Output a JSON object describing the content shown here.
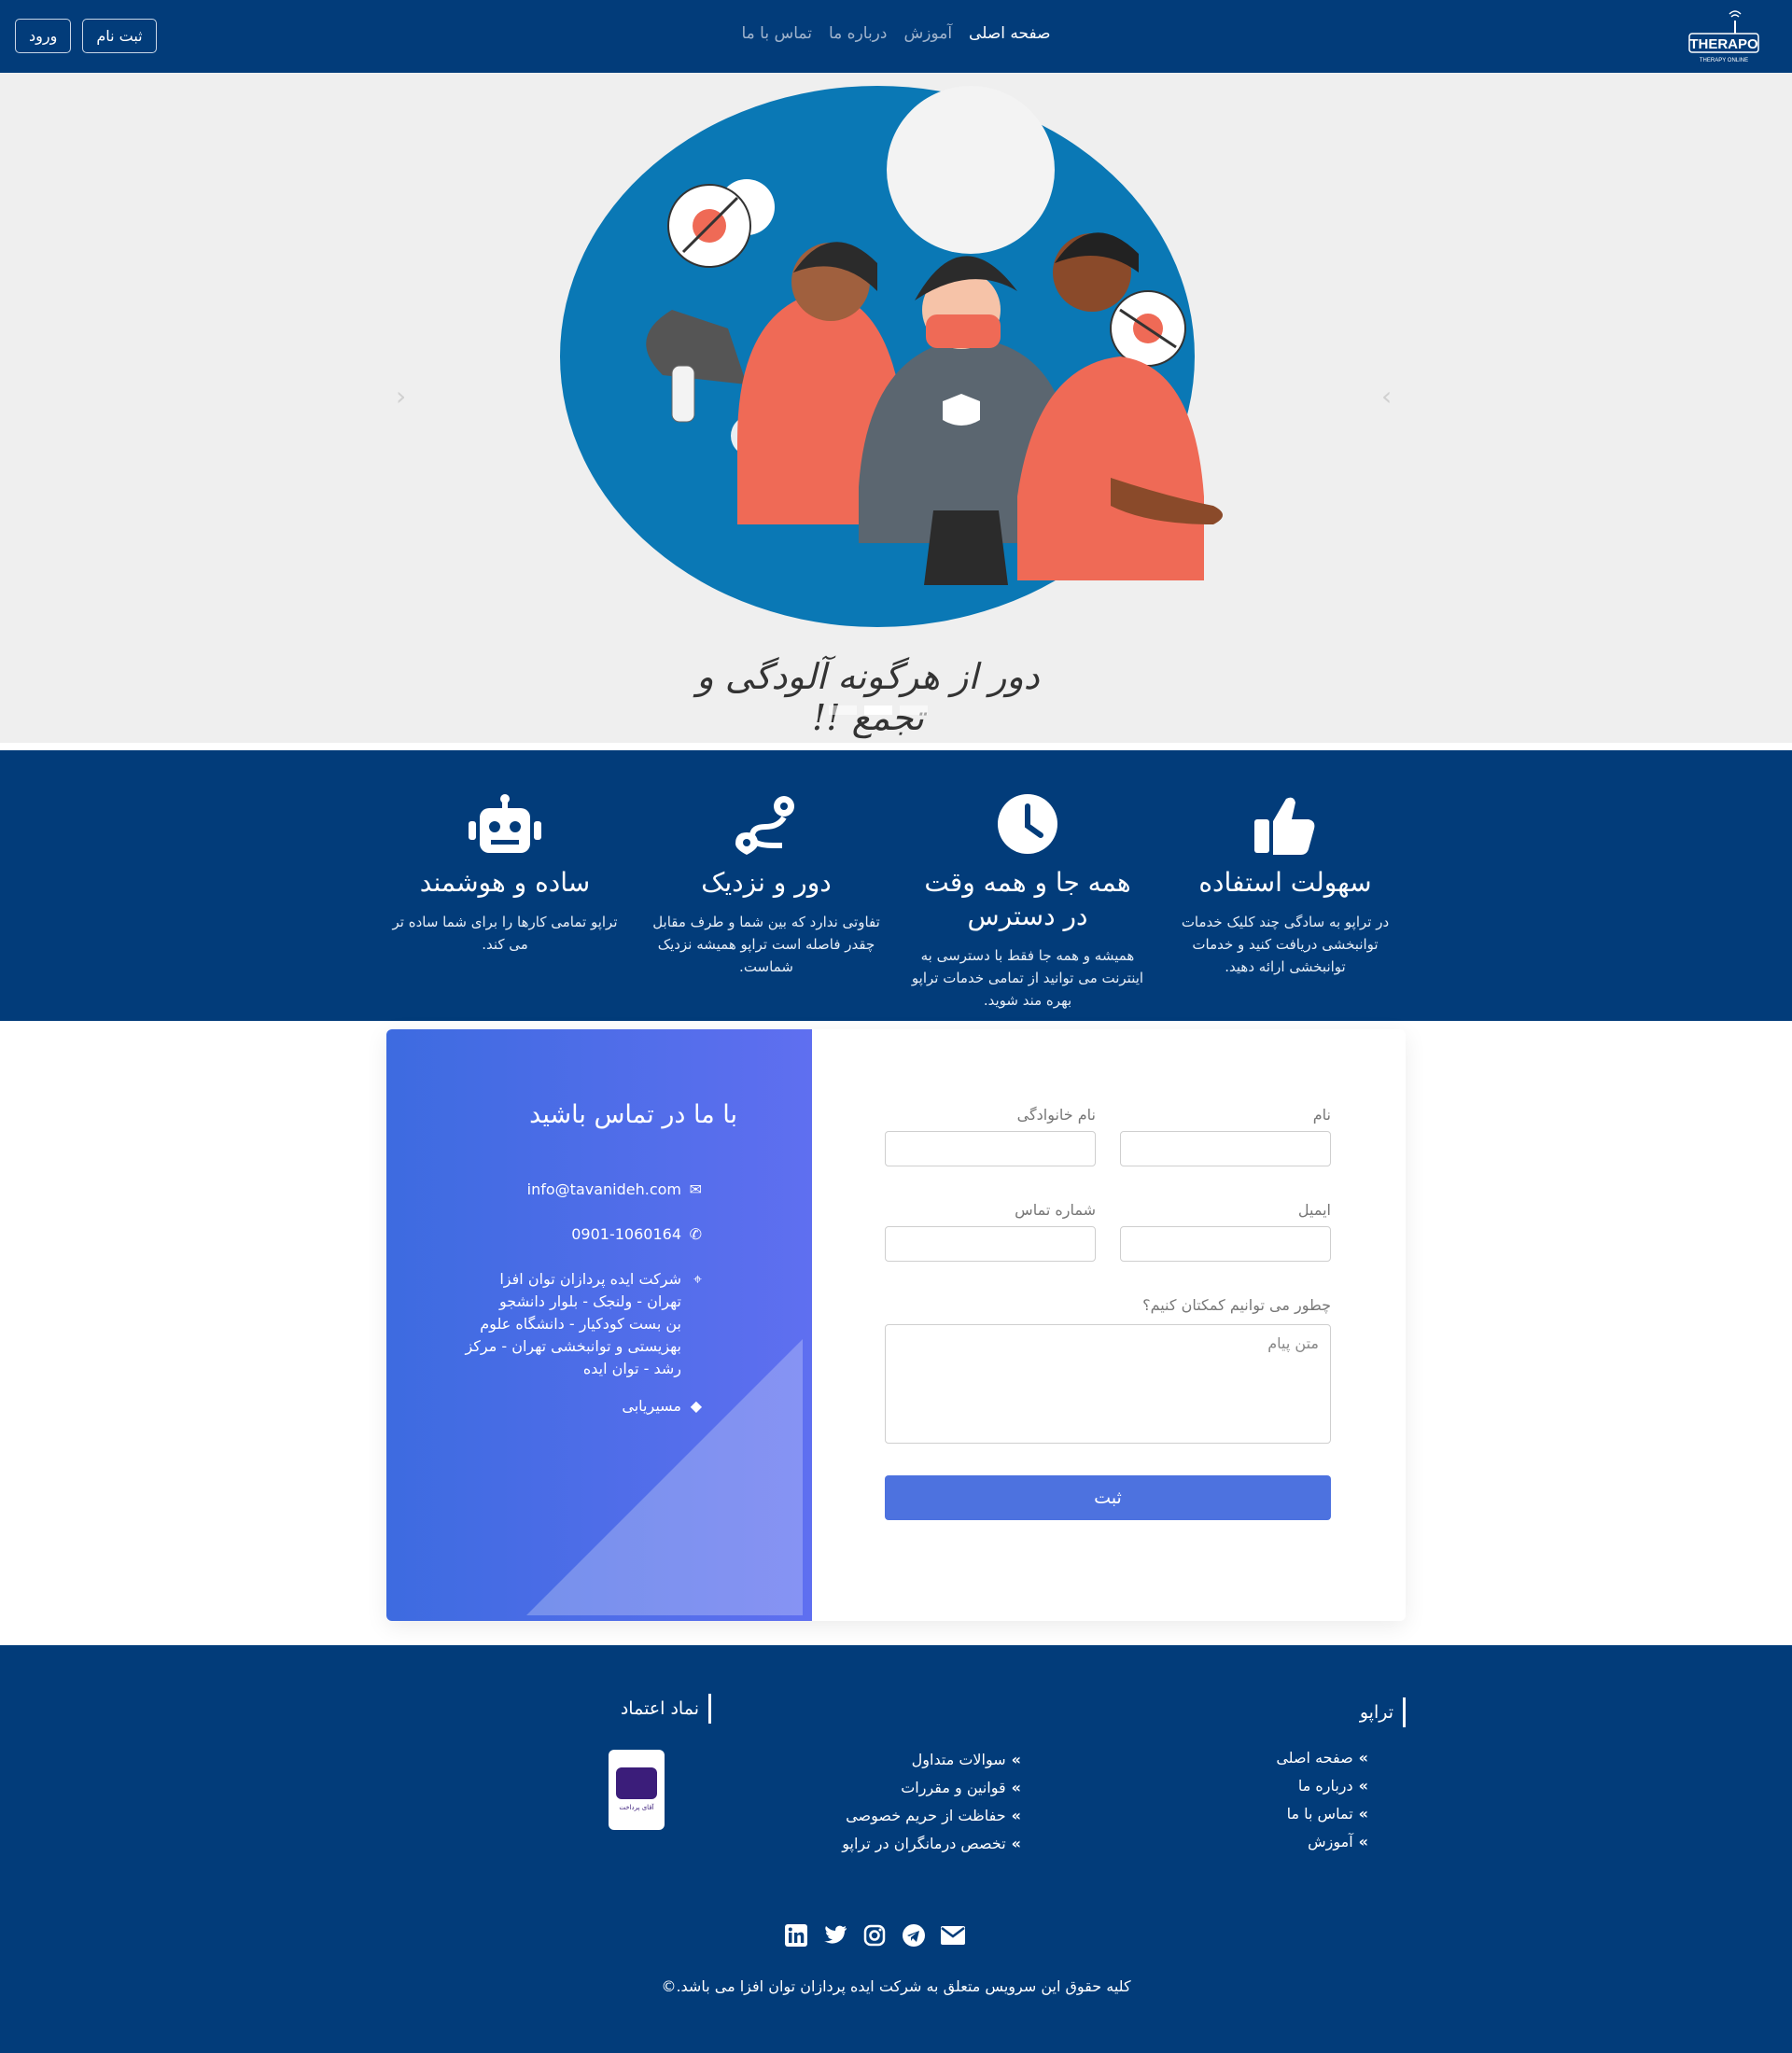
{
  "nav": {
    "logo_text": "THERAPO",
    "logo_sub": "THERAPY ONLINE",
    "links": [
      "صفحه اصلی",
      "آموزش",
      "درباره ما",
      "تماس با ما"
    ],
    "register": "ثبت نام",
    "login": "ورود"
  },
  "hero": {
    "caption": "دور از هرگونه آلودگی و تجمع !!",
    "slides": 3,
    "active_slide": 2
  },
  "features": [
    {
      "icon": "thumbs-up-icon",
      "title": "سهولت استفاده",
      "text": "در تراپو به سادگی چند کلیک خدمات توانبخشی دریافت کنید و خدمات توانبخشی ارائه دهید."
    },
    {
      "icon": "clock-icon",
      "title": "همه جا و همه وقت در دسترس",
      "text": "همیشه و همه جا فقط با دسترسی به اینترنت می توانید از تمامی خدمات تراپو بهره مند شوید."
    },
    {
      "icon": "route-icon",
      "title": "دور و نزدیک",
      "text": "تفاوتی ندارد که بین شما و طرف مقابل چقدر فاصله است تراپو همیشه نزدیک شماست."
    },
    {
      "icon": "robot-icon",
      "title": "ساده و هوشمند",
      "text": "تراپو تمامی کارها را برای شما ساده تر می کند."
    }
  ],
  "contact": {
    "title": "با ما در تماس باشید",
    "email": "info@tavanideh.com",
    "phone": "0901-1060164",
    "address_lines": [
      "شرکت ایده پردازان توان افزا",
      "تهران - ولنجک - بلوار دانشجو",
      "بن بست کودکیار - دانشگاه علوم",
      "بهزیستی و توانبخشی تهران - مرکز",
      "رشد - توان ایده"
    ],
    "directions": "مسیریابی",
    "form": {
      "first_name": "نام",
      "last_name": "نام خانوادگی",
      "email": "ایمیل",
      "phone": "شماره تماس",
      "question": "چطور می توانیم کمکتان کنیم؟",
      "message_placeholder": "متن پیام",
      "submit": "ثبت"
    }
  },
  "footer": {
    "col1_title": "تراپو",
    "col1_links": [
      "صفحه اصلی",
      "درباره ما",
      "تماس با ما",
      "آموزش"
    ],
    "col2_links": [
      "سوالات متداول",
      "قوانین و مقررات",
      "حفاظت از حریم خصوصی",
      "تخصص درمانگران در تراپو"
    ],
    "col3_title": "نماد اعتماد",
    "badge_text": "آقای پرداخت",
    "socials": [
      "linkedin-icon",
      "twitter-icon",
      "instagram-icon",
      "telegram-icon",
      "envelope-icon"
    ],
    "copyright": "کلیه حقوق این سرویس متعلق به شرکت ایده پردازان توان افزا می باشد.©"
  }
}
